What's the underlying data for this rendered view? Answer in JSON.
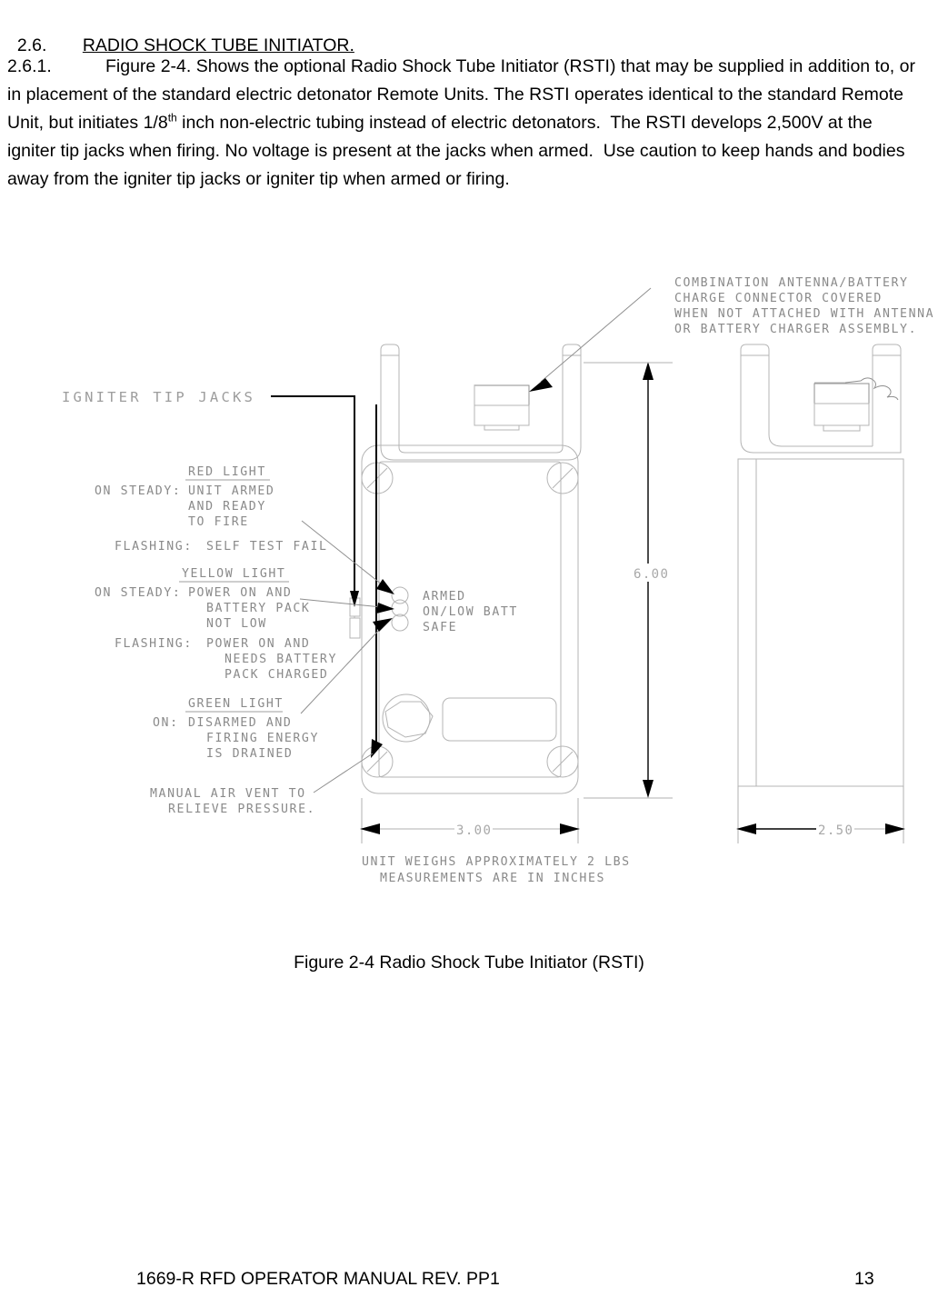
{
  "document": {
    "section_number": "2.6.",
    "section_title": "RADIO SHOCK TUBE INITIATOR.",
    "paragraph_number": "2.6.1.",
    "paragraph_text_before_sup": "Figure 2-4. Shows the optional Radio Shock Tube Initiator (RSTI) that may be supplied in addition to, or in placement of the standard electric detonator Remote Units. The RSTI operates identical to the standard Remote Unit, but initiates 1/8",
    "paragraph_superscript": "th",
    "paragraph_text_after_sup": " inch non-electric tubing instead of electric detonators.  The RSTI develops 2,500V at the igniter tip jacks when firing. No voltage is present at the jacks when armed.  Use caution to keep hands and bodies away from the igniter tip jacks or igniter tip when armed or firing.",
    "figure_caption": "Figure 2-4 Radio Shock Tube Initiator (RSTI)"
  },
  "footer": {
    "manual_title": "1669-R RFD OPERATOR MANUAL REV. PP1",
    "page_number": "13"
  },
  "figure": {
    "callouts": {
      "igniter_tip_jacks": "IGNITER TIP JACKS",
      "antenna_connector": [
        "COMBINATION ANTENNA/BATTERY",
        "CHARGE CONNECTOR COVERED",
        "WHEN NOT ATTACHED WITH ANTENNA",
        "OR BATTERY CHARGER ASSEMBLY."
      ],
      "manual_air_vent": [
        "MANUAL AIR VENT TO",
        "RELIEVE PRESSURE."
      ]
    },
    "led_legend": {
      "red": {
        "heading": "RED LIGHT",
        "rows": [
          {
            "label": "ON STEADY:",
            "lines": [
              "UNIT ARMED",
              "AND READY",
              "TO FIRE"
            ]
          },
          {
            "label": "FLASHING:",
            "lines": [
              "SELF TEST FAIL"
            ]
          }
        ]
      },
      "yellow": {
        "heading": "YELLOW LIGHT",
        "rows": [
          {
            "label": "ON STEADY:",
            "lines": [
              "POWER ON AND",
              "BATTERY PACK",
              "NOT LOW"
            ]
          },
          {
            "label": "FLASHING:",
            "lines": [
              "POWER ON AND",
              "NEEDS BATTERY",
              "PACK CHARGED"
            ]
          }
        ]
      },
      "green": {
        "heading": "GREEN LIGHT",
        "rows": [
          {
            "label": "ON:",
            "lines": [
              "DISARMED AND",
              "FIRING ENERGY",
              "IS DRAINED"
            ]
          }
        ]
      }
    },
    "panel_indicators": [
      "ARMED",
      "ON/LOW BATT",
      "SAFE"
    ],
    "dimensions": {
      "height": "6.00",
      "width_front": "3.00",
      "width_side": "2.50"
    },
    "notes": [
      "UNIT WEIGHS APPROXIMATELY 2 LBS",
      "MEASUREMENTS ARE IN INCHES"
    ]
  },
  "colors": {
    "text": "#000000",
    "cad_line": "#b4b4b4",
    "cad_text": "#8a8a8a",
    "page_background": "#ffffff"
  }
}
